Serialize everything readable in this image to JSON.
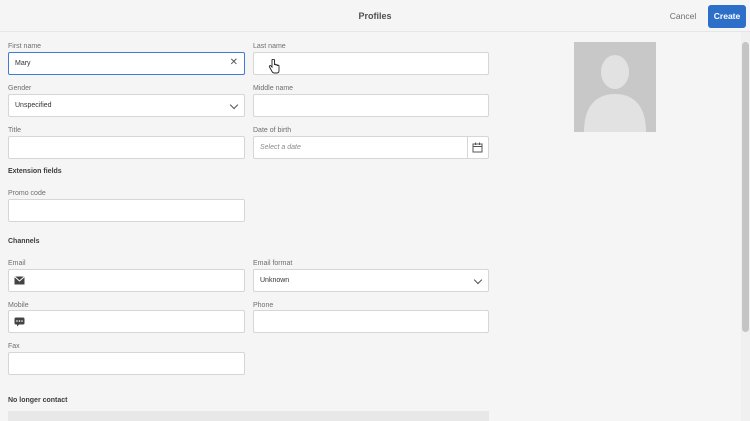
{
  "header": {
    "title": "Profiles",
    "cancel_label": "Cancel",
    "create_label": "Create"
  },
  "fields": {
    "first_name": {
      "label": "First name",
      "value": "Mary"
    },
    "last_name": {
      "label": "Last name",
      "value": ""
    },
    "gender": {
      "label": "Gender",
      "value": "Unspecified"
    },
    "middle_name": {
      "label": "Middle name",
      "value": ""
    },
    "title": {
      "label": "Title",
      "value": ""
    },
    "date_of_birth": {
      "label": "Date of birth",
      "placeholder": "Select a date"
    },
    "promo_code": {
      "label": "Promo code",
      "value": ""
    },
    "email": {
      "label": "Email",
      "value": ""
    },
    "email_format": {
      "label": "Email format",
      "value": "Unknown"
    },
    "mobile": {
      "label": "Mobile",
      "value": ""
    },
    "phone": {
      "label": "Phone",
      "value": ""
    },
    "fax": {
      "label": "Fax",
      "value": ""
    }
  },
  "sections": {
    "extension_fields": "Extension fields",
    "channels": "Channels",
    "no_longer_contact": "No longer contact"
  },
  "icons": {
    "clear": "close-icon",
    "dropdown": "chevron-down-icon",
    "calendar": "calendar-icon",
    "email": "envelope-icon",
    "mobile": "sms-icon",
    "avatar": "user-silhouette-icon"
  },
  "colors": {
    "accent": "#2d6ec9",
    "focus": "#3f7bd6"
  }
}
